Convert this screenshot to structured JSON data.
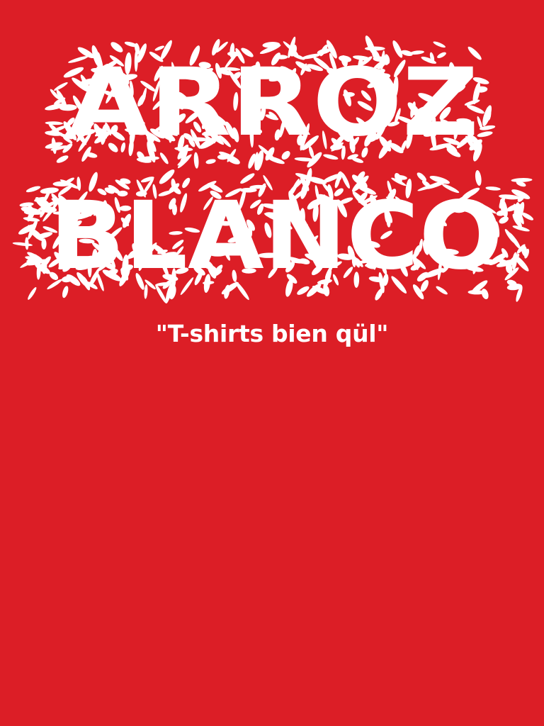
{
  "brand": {
    "line1": "ARROZ",
    "line2": "BLANCO",
    "tagline": "\"T-shirts bien qül\""
  },
  "colors": {
    "background": "#dc1e26",
    "foreground": "#ffffff"
  },
  "decoration": {
    "style": "rice-grain-scribble"
  }
}
